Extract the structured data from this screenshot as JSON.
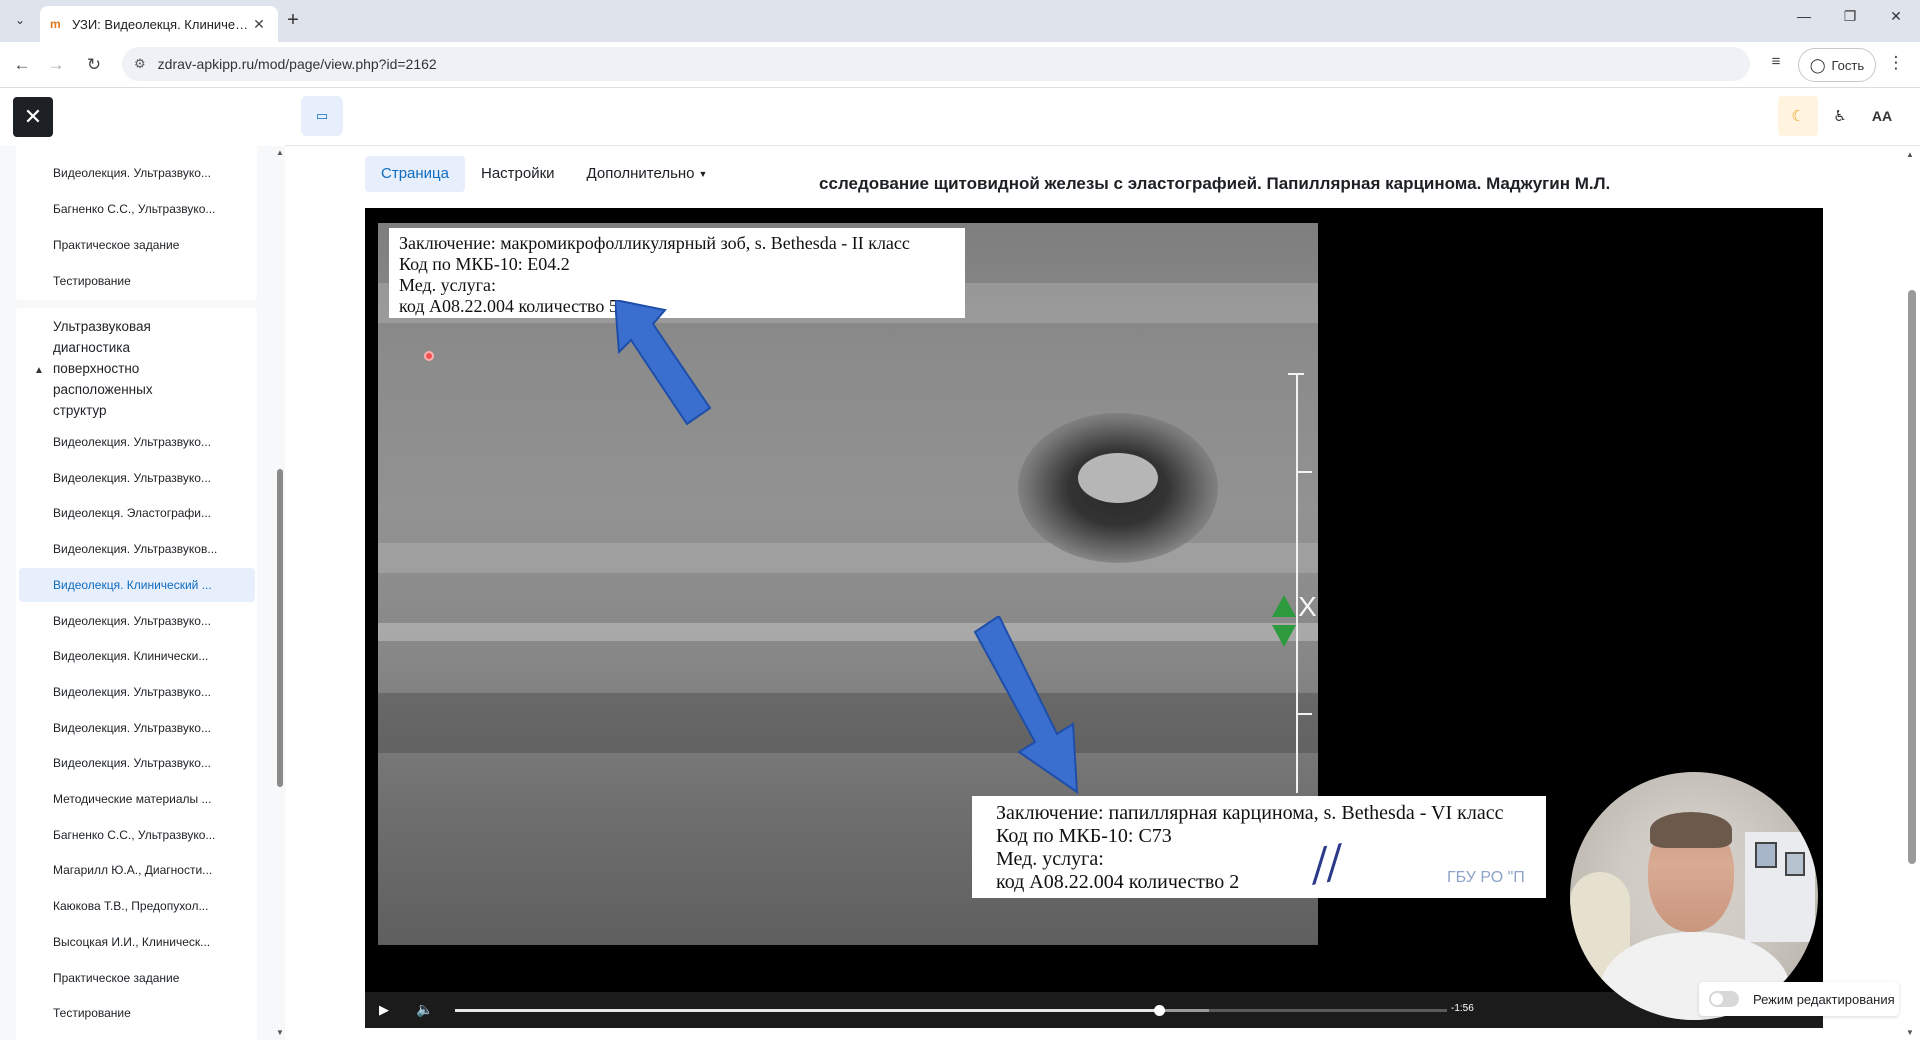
{
  "browser": {
    "tab_title": "УЗИ: Видеолекця. Клинический",
    "url": "zdrav-apkipp.ru/mod/page/view.php?id=2162",
    "guest_label": "Гость"
  },
  "header": {
    "font_size_label": "AA"
  },
  "sidebar": {
    "top_items": [
      "Видеолекция. Ультразвуко...",
      "Багненко С.С., Ультразвуко...",
      "Практическое задание",
      "Тестирование"
    ],
    "section_title": "Ультразвуковая диагностика поверхностно расположенных структур",
    "items": [
      "Видеолекция. Ультразвуко...",
      "Видеолекция. Ультразвуко...",
      "Видеолекця. Эластографи...",
      "Видеолекция. Ультразвуков...",
      "Видеолекця. Клинический ...",
      "Видеолекция. Ультразвуко...",
      "Видеолекция. Клинически...",
      "Видеолекция. Ультразвуко...",
      "Видеолекция. Ультразвуко...",
      "Видеолекция. Ультразвуко...",
      "Методические материалы ...",
      "Багненко С.С., Ультразвуко...",
      "Магарилл Ю.А., Диагности...",
      "Каюкова Т.В., Предопухол...",
      "Высоцкая И.И., Клиническ...",
      "Практическое задание",
      "Тестирование"
    ],
    "active_index": 4
  },
  "main": {
    "tabs": [
      "Страница",
      "Настройки",
      "Дополнительно"
    ],
    "heading": "Видеолекця. Клинический разбор. Ультразвуковое исследование щитовидной железы с эластографией. Папиллярная карцинома. Маджугин М.Л.",
    "heading_visible": "сследование щитовидной железы с эластографией. Папиллярная карцинома. Маджугин М.Л."
  },
  "video": {
    "note1": [
      "Заключение: макромикрофолликулярный зоб, s. Bethesda - II класс",
      "Код по МКБ-10: E04.2",
      "Мед. услуга:",
      "код A08.22.004 количество 5"
    ],
    "note2": [
      "Заключение: папиллярная карцинома, s. Bethesda - VI класс",
      "Код по МКБ-10: C73",
      "Мед. услуга:",
      "код A08.22.004 количество 2"
    ],
    "stamp_text": "ГБУ РО \"П",
    "marker_label": "X",
    "time_remaining": "-1:56",
    "progress": 0.71,
    "buffered": 0.76
  },
  "edit_mode_label": "Режим редактирования",
  "colors": {
    "accent": "#0f6cbf",
    "active_bg": "#e7eefc",
    "arrow": "#3a6fd0"
  }
}
